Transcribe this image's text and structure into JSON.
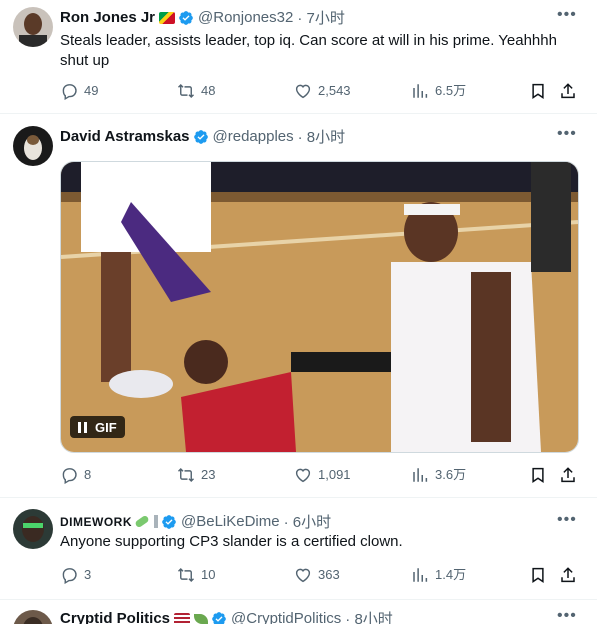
{
  "tweets": [
    {
      "name": "Ron Jones Jr",
      "handle": "@Ronjones32",
      "time": "· 7小时",
      "text": "Steals leader, assists leader, top iq. Can score at will in his prime. Yeahhhh shut up",
      "replies": "49",
      "retweets": "48",
      "likes": "2,543",
      "views": "6.5万"
    },
    {
      "name": "David Astramskas",
      "handle": "@redapples",
      "time": "· 8小时",
      "gif_label": "GIF",
      "replies": "8",
      "retweets": "23",
      "likes": "1,091",
      "views": "3.6万"
    },
    {
      "name": "DIMEWORK",
      "handle": "@BeLiKeDime",
      "time": "· 6小时",
      "text": "Anyone supporting CP3 slander is a certified clown.",
      "replies": "3",
      "retweets": "10",
      "likes": "363",
      "views": "1.4万"
    },
    {
      "name": "Cryptid Politics",
      "handle": "@CryptidPolitics",
      "time": "· 8小时"
    }
  ],
  "colors": {
    "verified": "#1d9bf0",
    "text_secondary": "#536471"
  },
  "icons": [
    "reply-icon",
    "retweet-icon",
    "like-icon",
    "views-icon",
    "bookmark-icon",
    "share-icon",
    "more-icon",
    "verified-badge-icon",
    "flag-icon",
    "pause-icon"
  ]
}
